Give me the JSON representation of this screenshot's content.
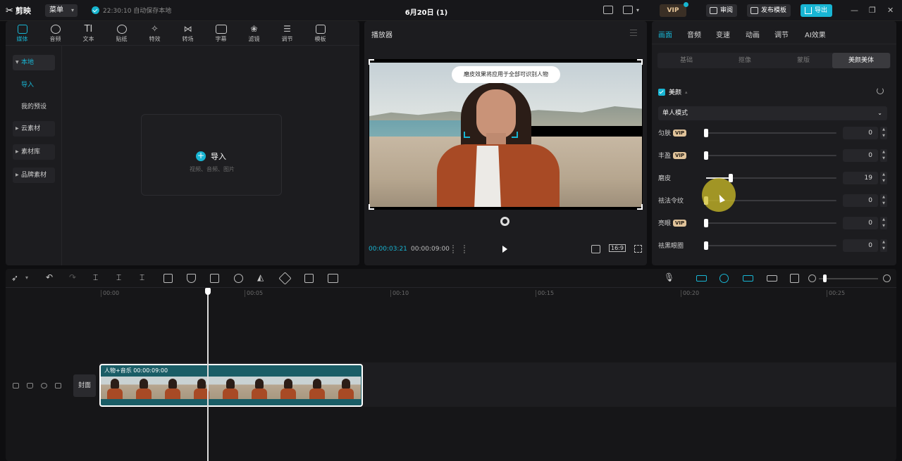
{
  "titlebar": {
    "app_name": "剪映",
    "menu_label": "菜单",
    "autosave_text": "22:30:10 自动保存本地",
    "project_title": "6月20日 (1)",
    "vip_label": "VIP",
    "review_label": "审阅",
    "publish_template_label": "发布模板",
    "export_label": "导出"
  },
  "media_tools": [
    {
      "label": "媒体",
      "icon": "media-icon",
      "active": true
    },
    {
      "label": "音频",
      "icon": "audio-icon"
    },
    {
      "label": "文本",
      "icon": "text-icon"
    },
    {
      "label": "贴纸",
      "icon": "sticker-icon"
    },
    {
      "label": "特效",
      "icon": "effects-icon"
    },
    {
      "label": "转场",
      "icon": "transition-icon"
    },
    {
      "label": "字幕",
      "icon": "subtitle-icon"
    },
    {
      "label": "滤镜",
      "icon": "filter-icon"
    },
    {
      "label": "调节",
      "icon": "adjust-icon"
    },
    {
      "label": "模板",
      "icon": "template-icon"
    }
  ],
  "sidebar": {
    "local": "本地",
    "import": "导入",
    "my_presets": "我的预设",
    "cloud": "云素材",
    "library": "素材库",
    "brand": "品牌素材"
  },
  "import_area": {
    "button": "导入",
    "hint": "视频、音频、图片"
  },
  "player": {
    "title": "播放器",
    "tooltip": "磨皮效果将应用于全部可识别人物",
    "current_time": "00:00:03:21",
    "total_time": "00:00:09:00",
    "ratio": "16:9"
  },
  "right_tabs": [
    "画面",
    "音频",
    "变速",
    "动画",
    "调节",
    "AI效果"
  ],
  "sub_tabs": [
    "基础",
    "抠像",
    "蒙版",
    "美颜美体"
  ],
  "beauty": {
    "header": "美颜",
    "mode": "单人模式",
    "sliders": [
      {
        "label": "匀肤",
        "vip": true,
        "value": "0",
        "fraction": 0.0
      },
      {
        "label": "丰盈",
        "vip": true,
        "value": "0",
        "fraction": 0.0
      },
      {
        "label": "磨皮",
        "vip": false,
        "value": "19",
        "fraction": 0.19
      },
      {
        "label": "祛法令纹",
        "vip": false,
        "value": "0",
        "fraction": 0.0
      },
      {
        "label": "亮眼",
        "vip": true,
        "value": "0",
        "fraction": 0.0
      },
      {
        "label": "祛黑眼圈",
        "vip": false,
        "value": "0",
        "fraction": 0.0
      }
    ],
    "vip_tag": "VIP"
  },
  "timeline": {
    "ticks": [
      "00:00",
      "00:05",
      "00:10",
      "00:15",
      "00:20",
      "00:25"
    ],
    "cover_label": "封面",
    "clip_label": "人物+音乐  00:00:09:00"
  },
  "colors": {
    "accent": "#18b5d3",
    "clip": "#1a5d66",
    "vip": "#e0c39a"
  }
}
